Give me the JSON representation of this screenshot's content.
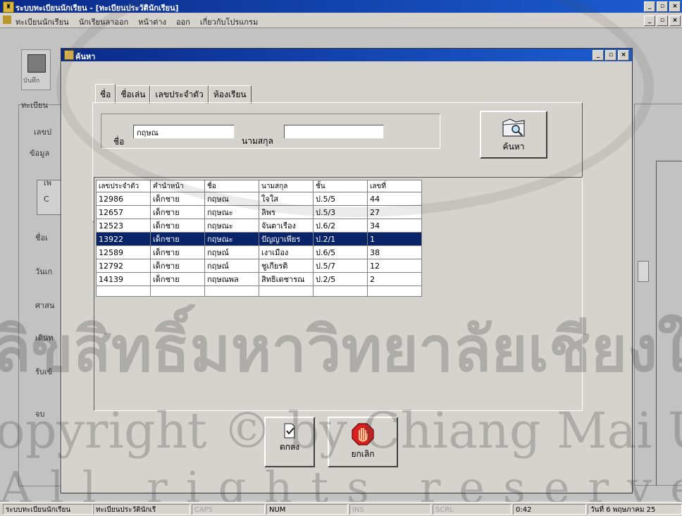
{
  "app": {
    "title": "ระบบทะเบียนนักเรียน - [ทะเบียนประวัตินักเรียน]",
    "window_buttons": [
      "_",
      "▫",
      "×"
    ]
  },
  "menu": {
    "items": [
      "ทะเบียนนักเรียน",
      "นักเรียนลาออก",
      "หน้าต่าง",
      "ออก",
      "เกี่ยวกับโปรแกรม"
    ]
  },
  "background_form": {
    "toolbar_label": "บันทึก",
    "labels": [
      "ทะเบียน",
      "เลขป",
      "ข้อมูล",
      "เพ",
      "C",
      "ชื่อเ",
      "วันเก",
      "ศาสน",
      "เดินท",
      "รับเข้",
      "จบ"
    ]
  },
  "dialog": {
    "title": "ค้นหา",
    "tabs": [
      "ชื่อ",
      "ชื่อเล่น",
      "เลขประจำตัว",
      "ห้องเรียน"
    ],
    "first_name_label": "ชื่อ",
    "first_name_value": "กฤษณ",
    "last_name_label": "นามสกุล",
    "last_name_value": "",
    "search_button": "ค้นหา",
    "ok_button": "ตกลง",
    "cancel_button": "ยกเลิก"
  },
  "results": {
    "columns": [
      "เลขประจำตัว",
      "คำนำหน้า",
      "ชื่อ",
      "นามสกุล",
      "ชั้น",
      "เลขที่"
    ],
    "rows": [
      [
        "12986",
        "เด็กชาย",
        "กฤษณ",
        "ใจใส",
        "ป.5/5",
        "44"
      ],
      [
        "12657",
        "เด็กชาย",
        "กฤษณะ",
        "ลิพร",
        "ป.5/3",
        "27"
      ],
      [
        "12523",
        "เด็กชาย",
        "กฤษณะ",
        "จันตาเรือง",
        "ป.6/2",
        "34"
      ],
      [
        "13922",
        "เด็กชาย",
        "กฤษณะ",
        "ปัญญาเพียร",
        "ป.2/1",
        "1"
      ],
      [
        "12589",
        "เด็กชาย",
        "กฤษณ์",
        "เงาเมือง",
        "ป.6/5",
        "38"
      ],
      [
        "12792",
        "เด็กชาย",
        "กฤษณ์",
        "ชูเกียรติ",
        "ป.5/7",
        "12"
      ],
      [
        "14139",
        "เด็กชาย",
        "กฤษณพล",
        "สิทธิเดชารณ",
        "ป.2/5",
        "2"
      ],
      [
        "",
        "",
        "",
        "",
        "",
        ""
      ]
    ],
    "selected_index": 3
  },
  "statusbar": {
    "app_name": "ระบบทะเบียนนักเรียน",
    "form_name": "ทะเบียนประวัตินักเรี",
    "caps": "CAPS",
    "num": "NUM",
    "ins": "INS",
    "scrl": "SCRL",
    "time": "0:42",
    "date": "วันที่ 6 พฤษภาคม 25"
  },
  "watermark": {
    "line1": "ลิขสิทธิ์มหาวิทยาลัยเชียงใหม่",
    "line2": "Copyright © by Chiang Mai University",
    "line3": "All rights reserved"
  },
  "colors": {
    "titlebar": "#0a2a8a",
    "selection": "#0a246a",
    "face": "#d6d3ce"
  }
}
